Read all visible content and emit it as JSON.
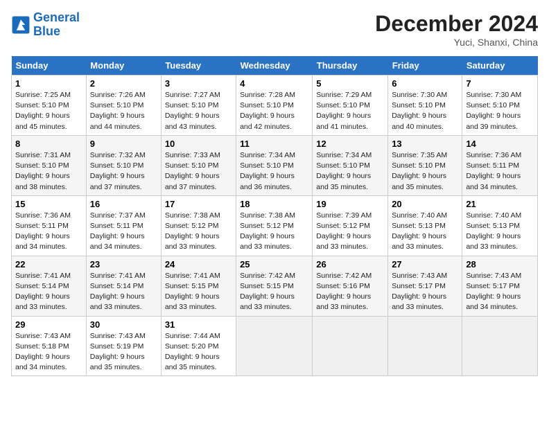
{
  "header": {
    "logo_general": "General",
    "logo_blue": "Blue",
    "month_title": "December 2024",
    "location": "Yuci, Shanxi, China"
  },
  "weekdays": [
    "Sunday",
    "Monday",
    "Tuesday",
    "Wednesday",
    "Thursday",
    "Friday",
    "Saturday"
  ],
  "weeks": [
    [
      {
        "day": "1",
        "sunrise": "Sunrise: 7:25 AM",
        "sunset": "Sunset: 5:10 PM",
        "daylight": "Daylight: 9 hours and 45 minutes."
      },
      {
        "day": "2",
        "sunrise": "Sunrise: 7:26 AM",
        "sunset": "Sunset: 5:10 PM",
        "daylight": "Daylight: 9 hours and 44 minutes."
      },
      {
        "day": "3",
        "sunrise": "Sunrise: 7:27 AM",
        "sunset": "Sunset: 5:10 PM",
        "daylight": "Daylight: 9 hours and 43 minutes."
      },
      {
        "day": "4",
        "sunrise": "Sunrise: 7:28 AM",
        "sunset": "Sunset: 5:10 PM",
        "daylight": "Daylight: 9 hours and 42 minutes."
      },
      {
        "day": "5",
        "sunrise": "Sunrise: 7:29 AM",
        "sunset": "Sunset: 5:10 PM",
        "daylight": "Daylight: 9 hours and 41 minutes."
      },
      {
        "day": "6",
        "sunrise": "Sunrise: 7:30 AM",
        "sunset": "Sunset: 5:10 PM",
        "daylight": "Daylight: 9 hours and 40 minutes."
      },
      {
        "day": "7",
        "sunrise": "Sunrise: 7:30 AM",
        "sunset": "Sunset: 5:10 PM",
        "daylight": "Daylight: 9 hours and 39 minutes."
      }
    ],
    [
      {
        "day": "8",
        "sunrise": "Sunrise: 7:31 AM",
        "sunset": "Sunset: 5:10 PM",
        "daylight": "Daylight: 9 hours and 38 minutes."
      },
      {
        "day": "9",
        "sunrise": "Sunrise: 7:32 AM",
        "sunset": "Sunset: 5:10 PM",
        "daylight": "Daylight: 9 hours and 37 minutes."
      },
      {
        "day": "10",
        "sunrise": "Sunrise: 7:33 AM",
        "sunset": "Sunset: 5:10 PM",
        "daylight": "Daylight: 9 hours and 37 minutes."
      },
      {
        "day": "11",
        "sunrise": "Sunrise: 7:34 AM",
        "sunset": "Sunset: 5:10 PM",
        "daylight": "Daylight: 9 hours and 36 minutes."
      },
      {
        "day": "12",
        "sunrise": "Sunrise: 7:34 AM",
        "sunset": "Sunset: 5:10 PM",
        "daylight": "Daylight: 9 hours and 35 minutes."
      },
      {
        "day": "13",
        "sunrise": "Sunrise: 7:35 AM",
        "sunset": "Sunset: 5:10 PM",
        "daylight": "Daylight: 9 hours and 35 minutes."
      },
      {
        "day": "14",
        "sunrise": "Sunrise: 7:36 AM",
        "sunset": "Sunset: 5:11 PM",
        "daylight": "Daylight: 9 hours and 34 minutes."
      }
    ],
    [
      {
        "day": "15",
        "sunrise": "Sunrise: 7:36 AM",
        "sunset": "Sunset: 5:11 PM",
        "daylight": "Daylight: 9 hours and 34 minutes."
      },
      {
        "day": "16",
        "sunrise": "Sunrise: 7:37 AM",
        "sunset": "Sunset: 5:11 PM",
        "daylight": "Daylight: 9 hours and 34 minutes."
      },
      {
        "day": "17",
        "sunrise": "Sunrise: 7:38 AM",
        "sunset": "Sunset: 5:12 PM",
        "daylight": "Daylight: 9 hours and 33 minutes."
      },
      {
        "day": "18",
        "sunrise": "Sunrise: 7:38 AM",
        "sunset": "Sunset: 5:12 PM",
        "daylight": "Daylight: 9 hours and 33 minutes."
      },
      {
        "day": "19",
        "sunrise": "Sunrise: 7:39 AM",
        "sunset": "Sunset: 5:12 PM",
        "daylight": "Daylight: 9 hours and 33 minutes."
      },
      {
        "day": "20",
        "sunrise": "Sunrise: 7:40 AM",
        "sunset": "Sunset: 5:13 PM",
        "daylight": "Daylight: 9 hours and 33 minutes."
      },
      {
        "day": "21",
        "sunrise": "Sunrise: 7:40 AM",
        "sunset": "Sunset: 5:13 PM",
        "daylight": "Daylight: 9 hours and 33 minutes."
      }
    ],
    [
      {
        "day": "22",
        "sunrise": "Sunrise: 7:41 AM",
        "sunset": "Sunset: 5:14 PM",
        "daylight": "Daylight: 9 hours and 33 minutes."
      },
      {
        "day": "23",
        "sunrise": "Sunrise: 7:41 AM",
        "sunset": "Sunset: 5:14 PM",
        "daylight": "Daylight: 9 hours and 33 minutes."
      },
      {
        "day": "24",
        "sunrise": "Sunrise: 7:41 AM",
        "sunset": "Sunset: 5:15 PM",
        "daylight": "Daylight: 9 hours and 33 minutes."
      },
      {
        "day": "25",
        "sunrise": "Sunrise: 7:42 AM",
        "sunset": "Sunset: 5:15 PM",
        "daylight": "Daylight: 9 hours and 33 minutes."
      },
      {
        "day": "26",
        "sunrise": "Sunrise: 7:42 AM",
        "sunset": "Sunset: 5:16 PM",
        "daylight": "Daylight: 9 hours and 33 minutes."
      },
      {
        "day": "27",
        "sunrise": "Sunrise: 7:43 AM",
        "sunset": "Sunset: 5:17 PM",
        "daylight": "Daylight: 9 hours and 33 minutes."
      },
      {
        "day": "28",
        "sunrise": "Sunrise: 7:43 AM",
        "sunset": "Sunset: 5:17 PM",
        "daylight": "Daylight: 9 hours and 34 minutes."
      }
    ],
    [
      {
        "day": "29",
        "sunrise": "Sunrise: 7:43 AM",
        "sunset": "Sunset: 5:18 PM",
        "daylight": "Daylight: 9 hours and 34 minutes."
      },
      {
        "day": "30",
        "sunrise": "Sunrise: 7:43 AM",
        "sunset": "Sunset: 5:19 PM",
        "daylight": "Daylight: 9 hours and 35 minutes."
      },
      {
        "day": "31",
        "sunrise": "Sunrise: 7:44 AM",
        "sunset": "Sunset: 5:20 PM",
        "daylight": "Daylight: 9 hours and 35 minutes."
      },
      null,
      null,
      null,
      null
    ]
  ]
}
